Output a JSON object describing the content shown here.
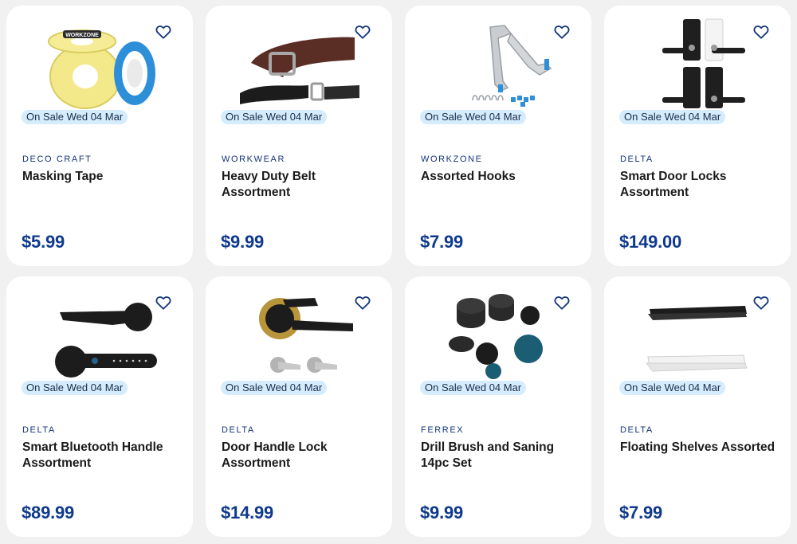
{
  "products": [
    {
      "badge": "On Sale Wed 04 Mar",
      "brand": "DECO CRAFT",
      "title": "Masking Tape",
      "price": "$5.99",
      "image_icon": "masking-tape-image",
      "tape_label": "WORKZONE"
    },
    {
      "badge": "On Sale Wed 04 Mar",
      "brand": "WORKWEAR",
      "title": "Heavy Duty Belt Assortment",
      "price": "$9.99",
      "image_icon": "belt-image"
    },
    {
      "badge": "On Sale Wed 04 Mar",
      "brand": "WORKZONE",
      "title": "Assorted Hooks",
      "price": "$7.99",
      "image_icon": "hooks-image"
    },
    {
      "badge": "On Sale Wed 04 Mar",
      "brand": "DELTA",
      "title": "Smart Door Locks Assortment",
      "price": "$149.00",
      "image_icon": "door-lock-image"
    },
    {
      "badge": "On Sale Wed 04 Mar",
      "brand": "DELTA",
      "title": "Smart Bluetooth Handle Assortment",
      "price": "$89.99",
      "image_icon": "bluetooth-handle-image"
    },
    {
      "badge": "On Sale Wed 04 Mar",
      "brand": "DELTA",
      "title": "Door Handle Lock Assortment",
      "price": "$14.99",
      "image_icon": "door-handle-image"
    },
    {
      "badge": "On Sale Wed 04 Mar",
      "brand": "FERREX",
      "title": "Drill Brush and Saning 14pc Set",
      "price": "$9.99",
      "image_icon": "drill-brush-image"
    },
    {
      "badge": "On Sale Wed 04 Mar",
      "brand": "DELTA",
      "title": "Floating Shelves Assorted",
      "price": "$7.99",
      "image_icon": "floating-shelves-image"
    }
  ],
  "favorite_icon": "heart-outline-icon",
  "colors": {
    "background": "#f1f1f1",
    "card": "#ffffff",
    "badge_bg": "#d4ecfb",
    "brand": "#13357a",
    "price": "#0f3a8c",
    "heart": "#13357a"
  }
}
